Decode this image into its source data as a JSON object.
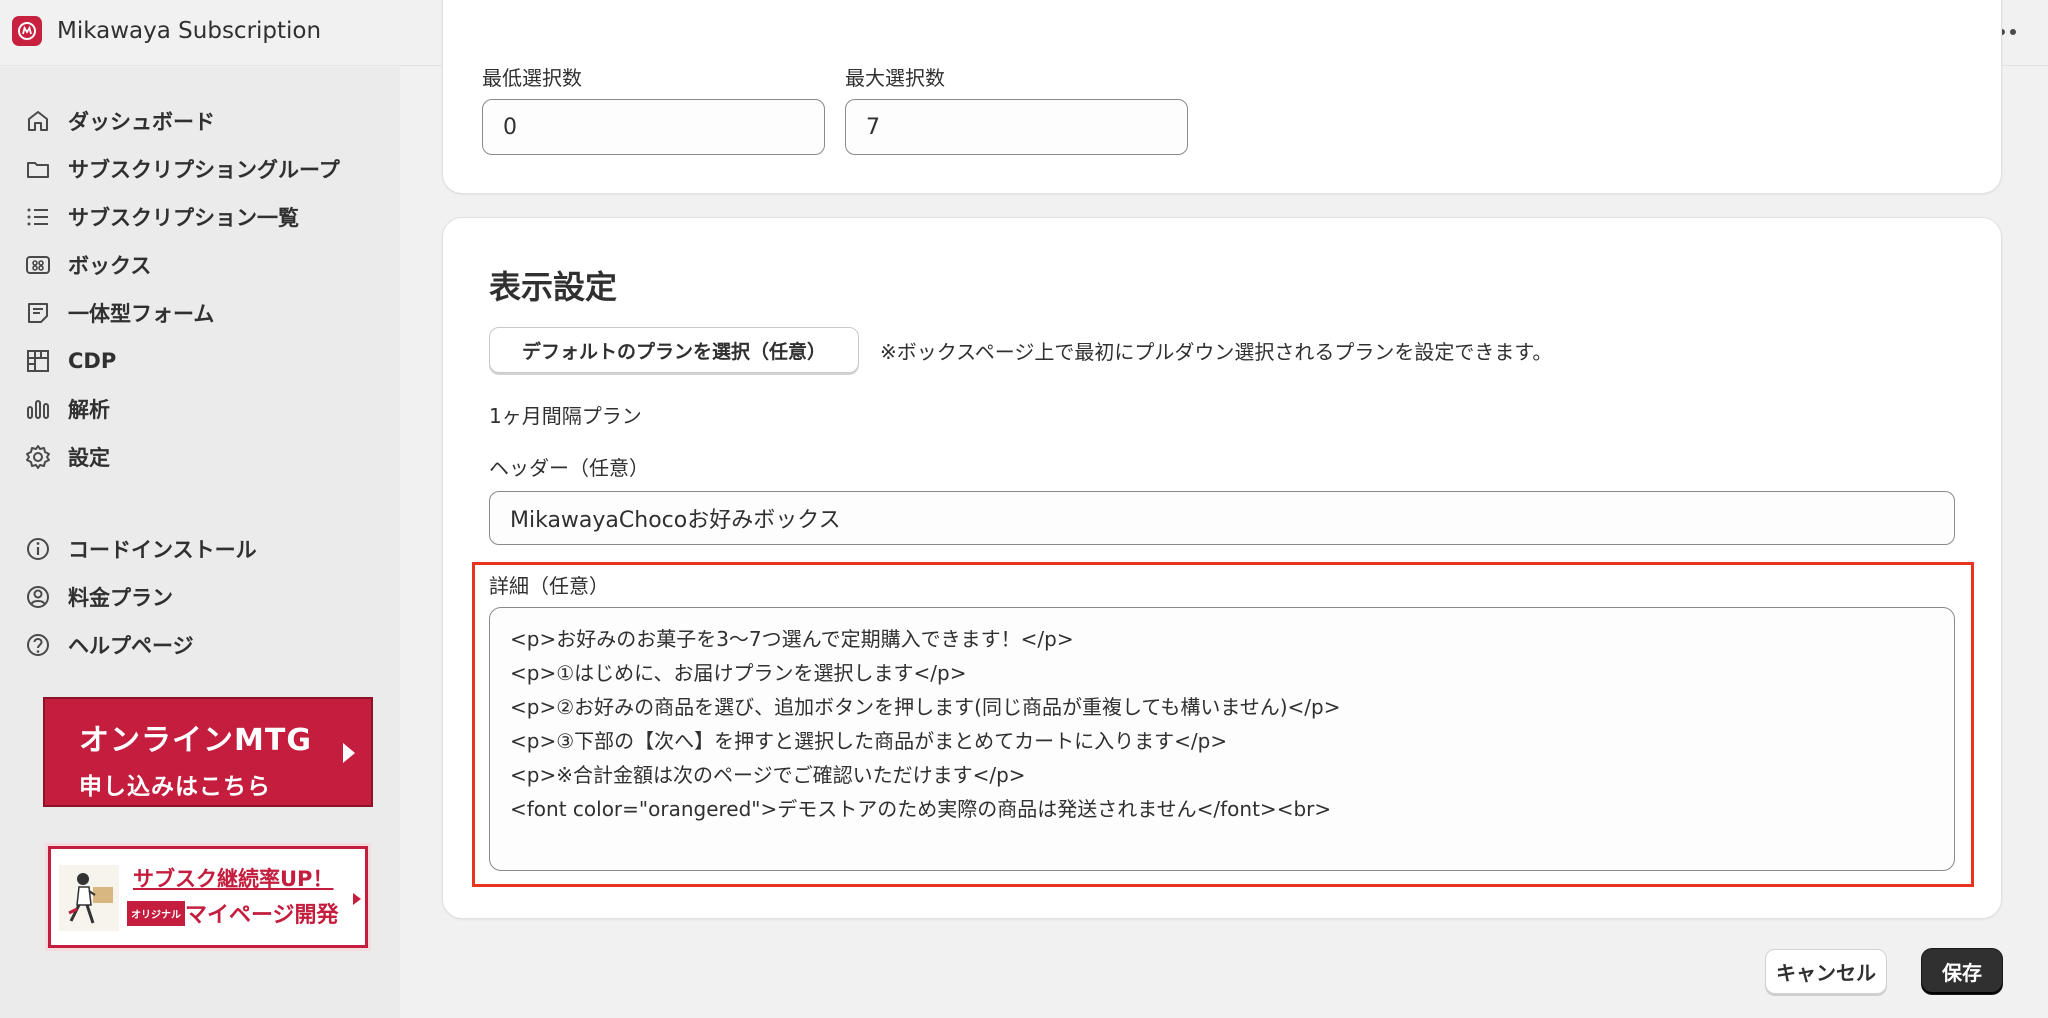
{
  "app": {
    "title": "Mikawaya Subscription"
  },
  "sidebar": {
    "items": [
      {
        "label": "ダッシュボード",
        "icon": "home-icon"
      },
      {
        "label": "サブスクリプショングループ",
        "icon": "folder-icon"
      },
      {
        "label": "サブスクリプション一覧",
        "icon": "list-icon"
      },
      {
        "label": "ボックス",
        "icon": "box-icon"
      },
      {
        "label": "一体型フォーム",
        "icon": "form-icon"
      },
      {
        "label": "CDP",
        "icon": "grid-icon"
      },
      {
        "label": "解析",
        "icon": "chart-icon"
      },
      {
        "label": "設定",
        "icon": "gear-icon"
      }
    ],
    "secondary_items": [
      {
        "label": "コードインストール",
        "icon": "info-icon"
      },
      {
        "label": "料金プラン",
        "icon": "user-circle-icon"
      },
      {
        "label": "ヘルプページ",
        "icon": "help-icon"
      }
    ],
    "banner_mtg": {
      "line1": "オンラインMTG",
      "line2": "申し込みはこちら"
    },
    "banner_mypage": {
      "line1": "サブスク継続率UP！",
      "tag": "オリジナル",
      "line2": "マイページ開発"
    }
  },
  "selection": {
    "min_label": "最低選択数",
    "min_value": "0",
    "max_label": "最大選択数",
    "max_value": "7"
  },
  "display_settings": {
    "title": "表示設定",
    "default_plan_button": "デフォルトのプランを選択（任意）",
    "default_plan_note": "※ボックスページ上で最初にプルダウン選択されるプランを設定できます。",
    "selected_plan": "1ヶ月間隔プラン",
    "header_label": "ヘッダー（任意）",
    "header_value": "MikawayaChocoお好みボックス",
    "detail_label": "詳細（任意）",
    "detail_lines": [
      "<p>お好みのお菓子を3〜7つ選んで定期購入できます！</p>",
      "<p>①はじめに、お届けプランを選択します</p>",
      "<p>②お好みの商品を選び、追加ボタンを押します(同じ商品が重複しても構いません)</p>",
      "<p>③下部の【次へ】を押すと選択した商品がまとめてカートに入ります</p>",
      "<p>※合計金額は次のページでご確認いただけます</p>",
      "<font color=\"orangered\">デモストアのため実際の商品は発送されません</font><br>"
    ]
  },
  "footer": {
    "cancel_label": "キャンセル",
    "save_label": "保存"
  },
  "colors": {
    "brand": "#c41d3d",
    "highlight": "#e8331f",
    "primary_button": "#303030"
  }
}
